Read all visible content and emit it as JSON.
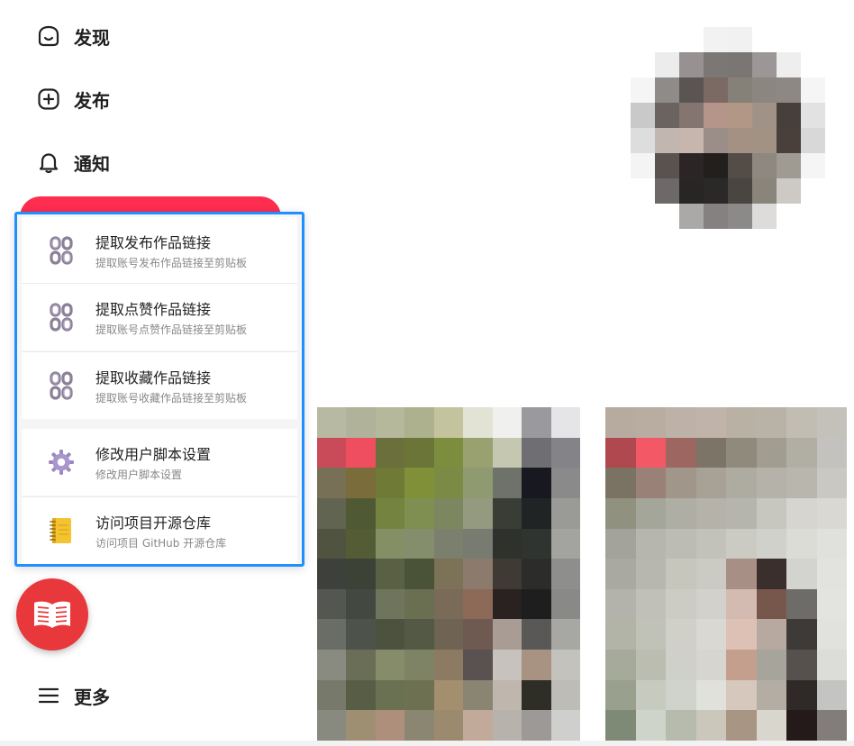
{
  "nav": {
    "discover_label": "发现",
    "publish_label": "发布",
    "notify_label": "通知",
    "more_label": "更多"
  },
  "menu": {
    "items": [
      {
        "title": "提取发布作品链接",
        "subtitle": "提取账号发布作品链接至剪贴板",
        "icon": "chain-link-icon"
      },
      {
        "title": "提取点赞作品链接",
        "subtitle": "提取账号点赞作品链接至剪贴板",
        "icon": "chain-link-icon"
      },
      {
        "title": "提取收藏作品链接",
        "subtitle": "提取账号收藏作品链接至剪贴板",
        "icon": "chain-link-icon"
      },
      {
        "title": "修改用户脚本设置",
        "subtitle": "修改用户脚本设置",
        "icon": "gear-icon"
      },
      {
        "title": "访问项目开源仓库",
        "subtitle": "访问项目 GitHub 开源仓库",
        "icon": "notebook-icon"
      }
    ]
  },
  "fab": {
    "icon": "open-book-icon"
  },
  "colors": {
    "accent_red": "#ff2d4f",
    "fab_red": "#e8383b",
    "popup_border": "#1e90ff"
  }
}
